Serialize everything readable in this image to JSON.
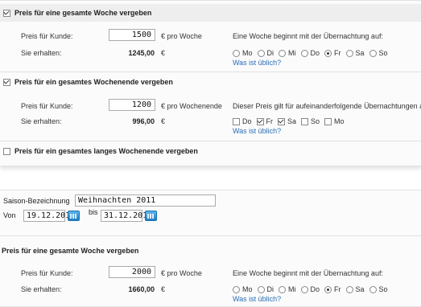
{
  "week": {
    "title": "Preis für eine gesamte Woche vergeben",
    "price_label": "Preis für Kunde:",
    "price_value": "1500",
    "price_unit": "€ pro Woche",
    "receive_label": "Sie erhalten:",
    "receive_value": "1245,00",
    "receive_unit": "€",
    "start_note": "Eine Woche beginnt mit der Übernachtung auf:",
    "days": [
      "Mo",
      "Di",
      "Mi",
      "Do",
      "Fr",
      "Sa",
      "So"
    ],
    "selected_day": "Fr",
    "link": "Was ist üblich?"
  },
  "weekend": {
    "title": "Preis für ein gesamtes Wochenende vergeben",
    "price_label": "Preis für Kunde:",
    "price_value": "1200",
    "price_unit": "€ pro Wochenende",
    "receive_label": "Sie erhalten:",
    "receive_value": "996,00",
    "receive_unit": "€",
    "note": "Dieser Preis gilt für aufeinanderfolgende Übernachtungen au",
    "days": [
      "Do",
      "Fr",
      "Sa",
      "So",
      "Mo"
    ],
    "checked_days": [
      "Fr",
      "Sa"
    ],
    "link": "Was ist üblich?"
  },
  "long_weekend": {
    "title": "Preis für ein gesamtes langes Wochenende vergeben"
  },
  "season": {
    "label": "Saison-Bezeichnung",
    "name_value": "Weihnachten 2011",
    "from_label": "Von",
    "from_value": "19.12.2011",
    "to_label": "bis",
    "to_value": "31.12.2011"
  },
  "season_week": {
    "title": "Preis für eine gesamte Woche vergeben",
    "price_label": "Preis für Kunde:",
    "price_value": "2000",
    "price_unit": "€ pro Woche",
    "receive_label": "Sie erhalten:",
    "receive_value": "1660,00",
    "receive_unit": "€",
    "start_note": "Eine Woche beginnt mit der Übernachtung auf:",
    "days": [
      "Mo",
      "Di",
      "Mi",
      "Do",
      "Fr",
      "Sa",
      "So"
    ],
    "selected_day": "Fr",
    "link": "Was ist üblich?"
  }
}
